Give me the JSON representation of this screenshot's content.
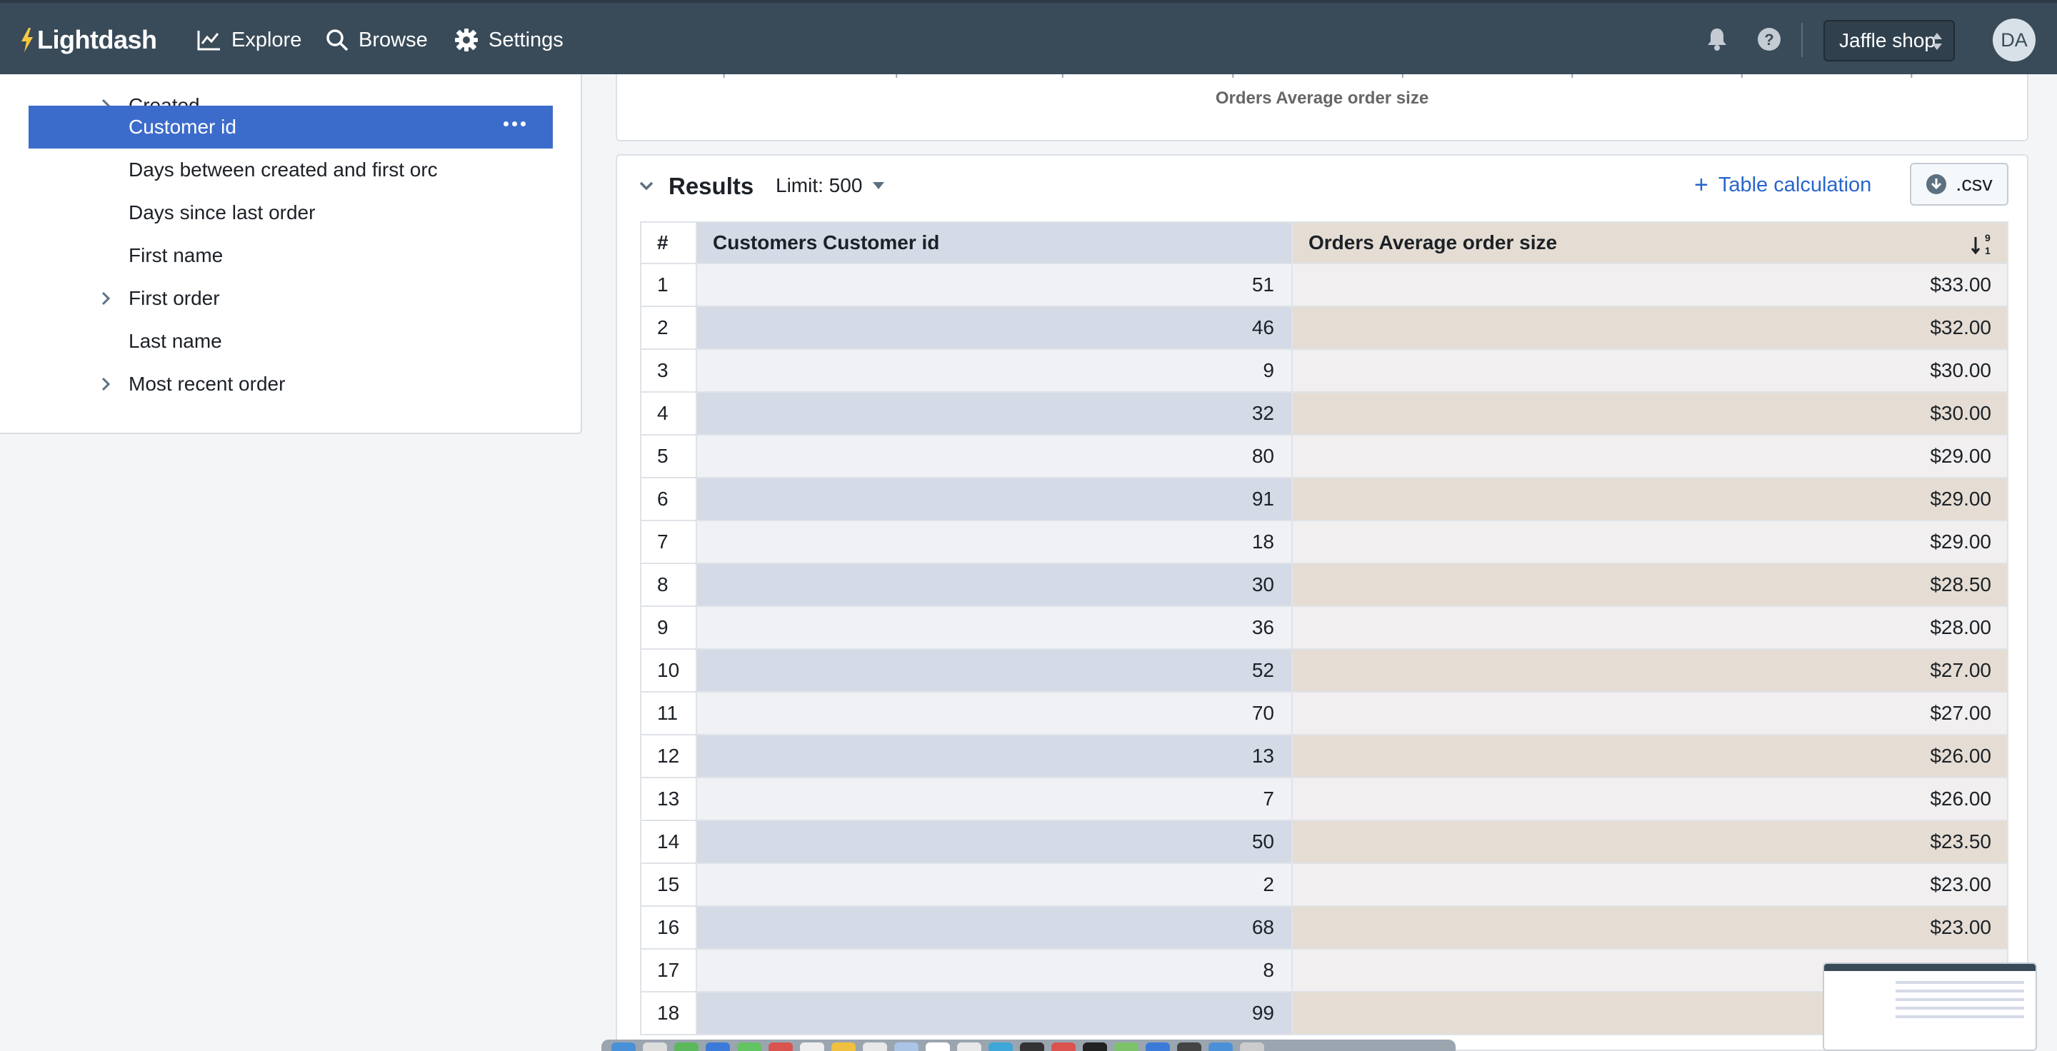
{
  "navbar": {
    "logo_text": "Lightdash",
    "items": [
      {
        "label": "Explore",
        "icon": "chart-line-icon"
      },
      {
        "label": "Browse",
        "icon": "search-icon"
      },
      {
        "label": "Settings",
        "icon": "gear-icon"
      }
    ],
    "project": "Jaffle shop",
    "avatar_initials": "DA",
    "colors": {
      "bg": "#394b59",
      "accent": "#3c6ccb"
    }
  },
  "sidebar": {
    "items": [
      {
        "label": "Created",
        "expandable": true,
        "selected": false
      },
      {
        "label": "Customer id",
        "expandable": false,
        "selected": true
      },
      {
        "label": "Days between created and first orc",
        "expandable": false,
        "selected": false
      },
      {
        "label": "Days since last order",
        "expandable": false,
        "selected": false
      },
      {
        "label": "First name",
        "expandable": false,
        "selected": false
      },
      {
        "label": "First order",
        "expandable": true,
        "selected": false
      },
      {
        "label": "Last name",
        "expandable": false,
        "selected": false
      },
      {
        "label": "Most recent order",
        "expandable": true,
        "selected": false
      }
    ]
  },
  "chart": {
    "x_axis_label": "Orders Average order size"
  },
  "results": {
    "title": "Results",
    "limit_label": "Limit: 500",
    "table_calc_label": "Table calculation",
    "csv_label": ".csv",
    "columns": [
      "#",
      "Customers Customer id",
      "Orders Average order size"
    ],
    "rows": [
      [
        "1",
        "51",
        "$33.00"
      ],
      [
        "2",
        "46",
        "$32.00"
      ],
      [
        "3",
        "9",
        "$30.00"
      ],
      [
        "4",
        "32",
        "$30.00"
      ],
      [
        "5",
        "80",
        "$29.00"
      ],
      [
        "6",
        "91",
        "$29.00"
      ],
      [
        "7",
        "18",
        "$29.00"
      ],
      [
        "8",
        "30",
        "$28.50"
      ],
      [
        "9",
        "36",
        "$28.00"
      ],
      [
        "10",
        "52",
        "$27.00"
      ],
      [
        "11",
        "70",
        "$27.00"
      ],
      [
        "12",
        "13",
        "$26.00"
      ],
      [
        "13",
        "7",
        "$26.00"
      ],
      [
        "14",
        "50",
        "$23.50"
      ],
      [
        "15",
        "2",
        "$23.00"
      ],
      [
        "16",
        "68",
        "$23.00"
      ],
      [
        "17",
        "8",
        ""
      ],
      [
        "18",
        "99",
        ""
      ]
    ]
  }
}
